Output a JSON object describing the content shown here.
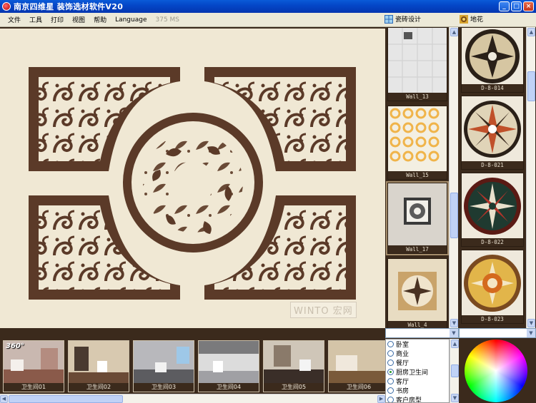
{
  "window": {
    "title": "南京四维星 装饰选材软件V20",
    "controls": [
      "_",
      "□",
      "×"
    ]
  },
  "menu": {
    "items": [
      "文件",
      "工具",
      "打印",
      "视图",
      "帮助",
      "Language"
    ],
    "status": "375 MS",
    "tool_tile_design": "瓷砖设计",
    "tool_floor_pattern": "地花"
  },
  "canvas": {
    "watermark": "WINTO 宏网"
  },
  "tiles_left": [
    {
      "label": "Wall_13"
    },
    {
      "label": "Wall_15"
    },
    {
      "label": "Wall_17"
    },
    {
      "label": "Wall_4"
    }
  ],
  "tiles_right": [
    {
      "label": "D-8-014"
    },
    {
      "label": "D-8-021"
    },
    {
      "label": "D-8-022"
    },
    {
      "label": "D-8-023"
    }
  ],
  "rooms": {
    "badge": "360°",
    "items": [
      {
        "label": "卫生间01"
      },
      {
        "label": "卫生间02"
      },
      {
        "label": "卫生间03"
      },
      {
        "label": "卫生间04"
      },
      {
        "label": "卫生间05"
      },
      {
        "label": "卫生间06"
      }
    ]
  },
  "categories": {
    "options": [
      "卧室",
      "商业",
      "餐厅",
      "厨房卫生间",
      "客厅",
      "书房",
      "客户房型"
    ],
    "selected": "厨房卫生间"
  },
  "colors": {
    "frame": "#3b2a1c",
    "pattern": "#5b3a28",
    "cream": "#f0e8d4",
    "titlebar": "#0447c8"
  }
}
